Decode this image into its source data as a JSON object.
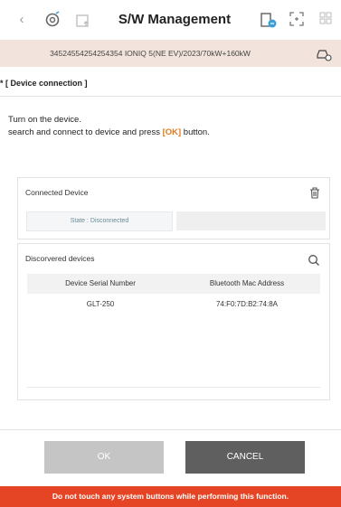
{
  "header": {
    "title": "S/W Management",
    "back_icon": "chevron-left-icon",
    "icons": [
      "connection-gear-icon",
      "home-upload-icon",
      "vci-device-icon",
      "screen-fit-icon",
      "grid-menu-icon"
    ]
  },
  "vehicle": {
    "vin": "34524554254254354",
    "model": "IONIQ 5(NE EV)/2023/70kW+160kW",
    "icon": "vehicle-settings-icon"
  },
  "section": {
    "title": "* [ Device connection ]"
  },
  "instructions": {
    "line1": "Turn on the device.",
    "line2_prefix": "search and connect to device and press ",
    "line2_ok": "[OK]",
    "line2_suffix": " button."
  },
  "connected_device": {
    "label": "Connected Device",
    "state": "State : Disconnected",
    "delete_icon": "trash-icon"
  },
  "discovered_devices": {
    "label": "Discorvered devices",
    "search_icon": "search-icon",
    "columns": [
      "Device Serial Number",
      "Bluetooth Mac Address"
    ],
    "rows": [
      [
        "GLT-250",
        "74:F0:7D:B2:74:8A"
      ]
    ]
  },
  "buttons": {
    "ok": "OK",
    "cancel": "CANCEL"
  },
  "warning": "Do not touch any system buttons while performing this function.",
  "colors": {
    "accent_orange": "#e07a1f",
    "warning_red": "#e54524",
    "vehicle_bar": "#f2e4dc",
    "cancel_button": "#5f5f5f",
    "ok_button_disabled": "#c5c5c5"
  }
}
